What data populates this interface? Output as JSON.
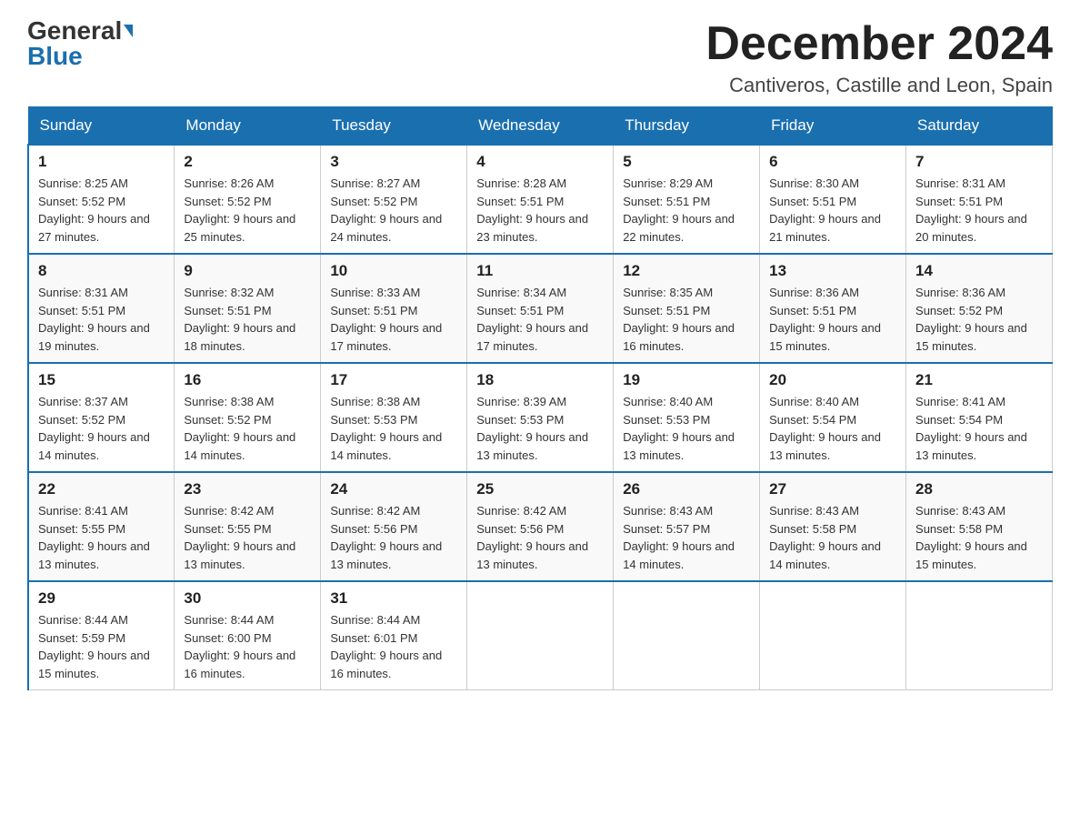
{
  "header": {
    "logo_general": "General",
    "logo_blue": "Blue",
    "month_year": "December 2024",
    "location": "Cantiveros, Castille and Leon, Spain"
  },
  "weekdays": [
    "Sunday",
    "Monday",
    "Tuesday",
    "Wednesday",
    "Thursday",
    "Friday",
    "Saturday"
  ],
  "weeks": [
    [
      {
        "day": "1",
        "sunrise": "8:25 AM",
        "sunset": "5:52 PM",
        "daylight": "9 hours and 27 minutes."
      },
      {
        "day": "2",
        "sunrise": "8:26 AM",
        "sunset": "5:52 PM",
        "daylight": "9 hours and 25 minutes."
      },
      {
        "day": "3",
        "sunrise": "8:27 AM",
        "sunset": "5:52 PM",
        "daylight": "9 hours and 24 minutes."
      },
      {
        "day": "4",
        "sunrise": "8:28 AM",
        "sunset": "5:51 PM",
        "daylight": "9 hours and 23 minutes."
      },
      {
        "day": "5",
        "sunrise": "8:29 AM",
        "sunset": "5:51 PM",
        "daylight": "9 hours and 22 minutes."
      },
      {
        "day": "6",
        "sunrise": "8:30 AM",
        "sunset": "5:51 PM",
        "daylight": "9 hours and 21 minutes."
      },
      {
        "day": "7",
        "sunrise": "8:31 AM",
        "sunset": "5:51 PM",
        "daylight": "9 hours and 20 minutes."
      }
    ],
    [
      {
        "day": "8",
        "sunrise": "8:31 AM",
        "sunset": "5:51 PM",
        "daylight": "9 hours and 19 minutes."
      },
      {
        "day": "9",
        "sunrise": "8:32 AM",
        "sunset": "5:51 PM",
        "daylight": "9 hours and 18 minutes."
      },
      {
        "day": "10",
        "sunrise": "8:33 AM",
        "sunset": "5:51 PM",
        "daylight": "9 hours and 17 minutes."
      },
      {
        "day": "11",
        "sunrise": "8:34 AM",
        "sunset": "5:51 PM",
        "daylight": "9 hours and 17 minutes."
      },
      {
        "day": "12",
        "sunrise": "8:35 AM",
        "sunset": "5:51 PM",
        "daylight": "9 hours and 16 minutes."
      },
      {
        "day": "13",
        "sunrise": "8:36 AM",
        "sunset": "5:51 PM",
        "daylight": "9 hours and 15 minutes."
      },
      {
        "day": "14",
        "sunrise": "8:36 AM",
        "sunset": "5:52 PM",
        "daylight": "9 hours and 15 minutes."
      }
    ],
    [
      {
        "day": "15",
        "sunrise": "8:37 AM",
        "sunset": "5:52 PM",
        "daylight": "9 hours and 14 minutes."
      },
      {
        "day": "16",
        "sunrise": "8:38 AM",
        "sunset": "5:52 PM",
        "daylight": "9 hours and 14 minutes."
      },
      {
        "day": "17",
        "sunrise": "8:38 AM",
        "sunset": "5:53 PM",
        "daylight": "9 hours and 14 minutes."
      },
      {
        "day": "18",
        "sunrise": "8:39 AM",
        "sunset": "5:53 PM",
        "daylight": "9 hours and 13 minutes."
      },
      {
        "day": "19",
        "sunrise": "8:40 AM",
        "sunset": "5:53 PM",
        "daylight": "9 hours and 13 minutes."
      },
      {
        "day": "20",
        "sunrise": "8:40 AM",
        "sunset": "5:54 PM",
        "daylight": "9 hours and 13 minutes."
      },
      {
        "day": "21",
        "sunrise": "8:41 AM",
        "sunset": "5:54 PM",
        "daylight": "9 hours and 13 minutes."
      }
    ],
    [
      {
        "day": "22",
        "sunrise": "8:41 AM",
        "sunset": "5:55 PM",
        "daylight": "9 hours and 13 minutes."
      },
      {
        "day": "23",
        "sunrise": "8:42 AM",
        "sunset": "5:55 PM",
        "daylight": "9 hours and 13 minutes."
      },
      {
        "day": "24",
        "sunrise": "8:42 AM",
        "sunset": "5:56 PM",
        "daylight": "9 hours and 13 minutes."
      },
      {
        "day": "25",
        "sunrise": "8:42 AM",
        "sunset": "5:56 PM",
        "daylight": "9 hours and 13 minutes."
      },
      {
        "day": "26",
        "sunrise": "8:43 AM",
        "sunset": "5:57 PM",
        "daylight": "9 hours and 14 minutes."
      },
      {
        "day": "27",
        "sunrise": "8:43 AM",
        "sunset": "5:58 PM",
        "daylight": "9 hours and 14 minutes."
      },
      {
        "day": "28",
        "sunrise": "8:43 AM",
        "sunset": "5:58 PM",
        "daylight": "9 hours and 15 minutes."
      }
    ],
    [
      {
        "day": "29",
        "sunrise": "8:44 AM",
        "sunset": "5:59 PM",
        "daylight": "9 hours and 15 minutes."
      },
      {
        "day": "30",
        "sunrise": "8:44 AM",
        "sunset": "6:00 PM",
        "daylight": "9 hours and 16 minutes."
      },
      {
        "day": "31",
        "sunrise": "8:44 AM",
        "sunset": "6:01 PM",
        "daylight": "9 hours and 16 minutes."
      },
      null,
      null,
      null,
      null
    ]
  ]
}
